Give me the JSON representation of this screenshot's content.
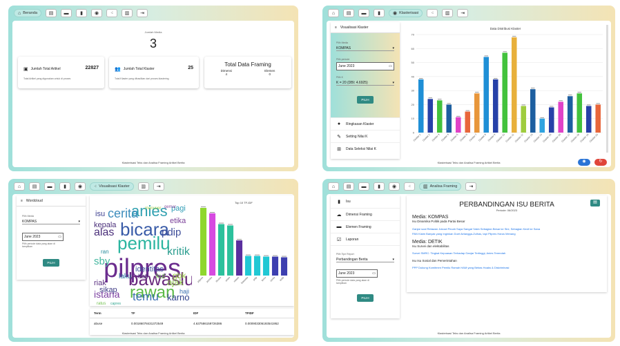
{
  "panel1": {
    "tab_label": "Beranda",
    "media_label": "Jumlah Media",
    "media_count": "3",
    "artikel_title": "Jumlah Total Artikel",
    "artikel_value": "22827",
    "artikel_desc": "Total Artikel yang digunakan untuk di proses",
    "klaster_title": "Jumlah Total Klaster",
    "klaster_value": "25",
    "klaster_desc": "Total Klaster yang dihasilkan dari proses klastering",
    "framing_title": "Total Data Framing",
    "dimensi_label": "Dimensi",
    "elemen_label": "Elemen",
    "dimensi_value": "4",
    "elemen_value": "0",
    "footer": "Klasterisasi Teks dan Analisa Framing Artikel Berita"
  },
  "panel2": {
    "tab_label": "Klasterisasi",
    "side_title": "Visualisasi Klaster",
    "media_label": "Pilih Media",
    "media_value": "KOMPAS",
    "periode_label": "Pilih periode",
    "periode_value": "June 2023",
    "k_label": "Pilih K",
    "k_value": "K = 20 (DBI: 4.6925)",
    "btn": "PILIH",
    "menu": [
      "Ringkasan Klaster",
      "Setting Nilai K",
      "Data Seleksi Nilai K"
    ],
    "footer": "Klasterisasi Teks dan Analisa Framing Artikel Berita"
  },
  "panel3": {
    "tab_label": "Visualisasi Klaster",
    "side_title": "Wordcloud",
    "media_label": "Pilih Media",
    "media_value": "KOMPAS",
    "periode_value": "June 2023",
    "periode_hint": "Pilih periode data yang akan di tampilkan",
    "btn": "PILIH",
    "words": [
      {
        "t": "pilpres",
        "c": "#6b2d8e"
      },
      {
        "t": "pemilu",
        "c": "#2bb5a0"
      },
      {
        "t": "bicara",
        "c": "#3a5ca8"
      },
      {
        "t": "anies",
        "c": "#30a0b0"
      },
      {
        "t": "rawan",
        "c": "#5cba47"
      },
      {
        "t": "bawaslu",
        "c": "#6a2b7e"
      },
      {
        "t": "pdip",
        "c": "#3f4e9a"
      },
      {
        "t": "cerita",
        "c": "#3e8dbc"
      },
      {
        "t": "temu",
        "c": "#3b6fb0"
      },
      {
        "t": "kritik",
        "c": "#2a9d8f"
      },
      {
        "t": "alas",
        "c": "#4a2f7a"
      },
      {
        "t": "istana",
        "c": "#7b3fa0"
      },
      {
        "t": "ajak",
        "c": "#88c540"
      },
      {
        "t": "karno",
        "c": "#2c3e8a"
      },
      {
        "t": "sby",
        "c": "#45b7a0"
      },
      {
        "t": "identitas",
        "c": "#3d4f9b"
      },
      {
        "t": "etika",
        "c": "#7a3f98"
      },
      {
        "t": "gbk",
        "c": "#9fd14a"
      },
      {
        "t": "laku",
        "c": "#2a6f9e"
      },
      {
        "t": "hati",
        "c": "#4b2a72"
      },
      {
        "t": "kut",
        "c": "#6fbf4b"
      },
      {
        "t": "pagi",
        "c": "#2e9cb5"
      },
      {
        "t": "isu",
        "c": "#3c3f8f"
      },
      {
        "t": "kepala",
        "c": "#4a2f7a"
      },
      {
        "t": "sikap",
        "c": "#3e3b85"
      },
      {
        "t": "riak",
        "c": "#5a2f80"
      },
      {
        "t": "haji",
        "c": "#3b6fb0"
      },
      {
        "t": "ran",
        "c": "#2a8e9e"
      },
      {
        "t": "manuver",
        "c": "#9bcc46"
      },
      {
        "t": "gemar",
        "c": "#8a4fa0"
      },
      {
        "t": "ratus",
        "c": "#6fbf4b"
      },
      {
        "t": "capres",
        "c": "#2fa58e"
      }
    ],
    "chart_title": "Top 10 TF-IDF",
    "table_headers": [
      "Term",
      "TF",
      "IDF",
      "TFIDF"
    ],
    "table_row": [
      "abuse",
      "0.00186078431372549",
      "4.637586159726386",
      "0.000903306193541952"
    ],
    "footer": "Klasterisasi Teks dan Analisa Framing Artikel Berita"
  },
  "panel4": {
    "tab_label": "Analisa Framing",
    "menu": [
      "Isu",
      "Dimensi Framing",
      "Elemen Framing",
      "Laporan"
    ],
    "report_label": "Pilih Tipe Report",
    "report_value": "Perbandingan Berita",
    "periode_value": "June 2023",
    "periode_hint": "Pilih periode data yang akan di tampilkan",
    "btn": "PILIH",
    "title": "PERBANDINGAN ISU BERITA",
    "period": "Periode: 06/2023",
    "media1": "Media: KOMPAS",
    "media1_isu": "Isu Dinamika Politik pada Partai Besar",
    "media1_links": [
      "Ganjar soal Relawan Jokowi Pecah Saya Sangat Yakin Sebagian Besar ke Sini, Sebagian Kecil ke Sana",
      "PAN Klaim Banyak yang Inginkan Duet Airlangga-Zulhas, tapi Pilpres Harus Menang"
    ],
    "media2": "Media: DETIK",
    "media2_isu": "Isu Survei dan elektabilitas",
    "media2_links": [
      "Survei SMRC: Tingkat Kepuasan Terhadap Ganjar Tertinggi, Anies Terendah"
    ],
    "media2_isu2": "Isu Isu Sosial dan Pemerintahan",
    "media2_links2": [
      "PPP Dukung Komitmen Pemilu Ramah HAM yang Bebas Hoaks & Diskriminasi"
    ],
    "footer": "Klasterisasi Teks dan Analisa Framing Artikel Berita"
  },
  "chart_data": [
    {
      "type": "bar",
      "title": "Data Distribusi Klaster",
      "categories": [
        "Cluster 1",
        "Cluster 2",
        "Cluster 3",
        "Cluster 4",
        "Cluster 5",
        "Cluster 6",
        "Cluster 7",
        "Cluster 8",
        "Cluster 9",
        "Cluster 10",
        "Cluster 11",
        "Cluster 12",
        "Cluster 13",
        "Cluster 14",
        "Cluster 15",
        "Cluster 16",
        "Cluster 17",
        "Cluster 18",
        "Cluster 19",
        "Cluster 20"
      ],
      "values": [
        38,
        24,
        23,
        20,
        11,
        15,
        28,
        54,
        38,
        57,
        68,
        19,
        31,
        10,
        18,
        22,
        26,
        28,
        19,
        20
      ],
      "colors": [
        "#1f8fd6",
        "#2741a8",
        "#43c23d",
        "#1d5fa0",
        "#e043c8",
        "#e8663b",
        "#e8963b",
        "#1f8fd6",
        "#2741a8",
        "#43c23d",
        "#e8b03b",
        "#9fcc3e",
        "#1d5fa0",
        "#2fa3e0",
        "#2741a8",
        "#e043c8",
        "#1d5fa0",
        "#43c23d",
        "#2741a8",
        "#e8663b"
      ],
      "ylim": [
        0,
        70
      ],
      "yticks": [
        0,
        10,
        20,
        30,
        40,
        50,
        60,
        70
      ]
    },
    {
      "type": "bar",
      "title": "Top 10 TF-IDF",
      "categories": [
        "pilpres",
        "pemilu",
        "bicara",
        "anies",
        "rawan",
        "bawaslu",
        "pdip",
        "temu",
        "cerita",
        "kritik"
      ],
      "values": [
        1.0,
        0.92,
        0.76,
        0.74,
        0.52,
        0.29,
        0.29,
        0.28,
        0.28,
        0.27
      ],
      "colors": [
        "#8fd72e",
        "#d64ae0",
        "#2cc19c",
        "#2cc19c",
        "#5a2f9e",
        "#20c8d4",
        "#20c8d4",
        "#20c8d4",
        "#3d3fb0",
        "#3d3fb0"
      ],
      "ylim": [
        0,
        1.0
      ]
    }
  ]
}
